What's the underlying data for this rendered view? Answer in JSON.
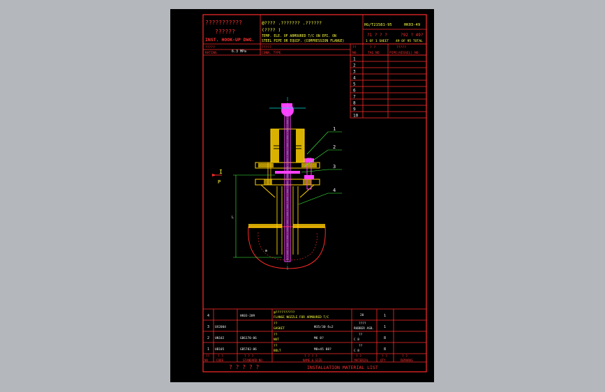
{
  "colors": {
    "frame": "#ff2a2a",
    "text_red": "#ff3030",
    "text_white": "#f0f0f0",
    "text_yellow": "#ffff40",
    "text_green": "#40ff40",
    "magenta": "#ff40ff",
    "cyan": "#00e0e0",
    "leader": "#40ff40",
    "background": "#000000",
    "canvas": "#b4b8bd"
  },
  "header": {
    "company_l1": "???????????",
    "company_l2": "??????",
    "dept": "INST. HOOK-UP DWG.",
    "title_cn": "@???? .??????? .??????",
    "title_cn2": "(???? )",
    "title_en1": "TEMP. ELE. OF ARMOURED T/C ON EPI. ON",
    "title_en2": "STEEL PIPE OR EQUIP. (COMPRESSION FLANGE)",
    "std_code": "HG/T21581-95",
    "dwg_no": "HK03-49",
    "sheet_q": "?1 ? ? ?",
    "sheet_total_q": "?92 ? 49?",
    "sheet_en": "1 OF 1 SHEET",
    "total_en": "49 OF 95 TOTAL",
    "rating_label": "?????",
    "rating_en": "RATING",
    "rating_value": "6.3 MPa",
    "conn_label": "?????",
    "conn_en": "CONN. TYPE"
  },
  "tag_table": {
    "headers": [
      {
        "cn": "??",
        "en": "NO."
      },
      {
        "cn": "? ?",
        "en": "TAG NO"
      },
      {
        "cn": "?????",
        "en": "PIPE(VESSEL) NO."
      }
    ],
    "rows": [
      "1",
      "2",
      "3",
      "4",
      "5",
      "6",
      "7",
      "8",
      "9",
      "10"
    ]
  },
  "drawing": {
    "callouts": [
      "1",
      "2",
      "3",
      "4"
    ],
    "section_mark": "I",
    "section_letter": "P",
    "dim_l": "L",
    "dim_m": "m"
  },
  "bom": {
    "rows": [
      {
        "no": "4",
        "code": "",
        "std": "HK03-209",
        "name_cn": "@??????????",
        "name_en": "FLANGE NOZZLE FOR ARMOURED T/C",
        "spec": "",
        "mat": "20",
        "qty": "1",
        "rem": ""
      },
      {
        "no": "3",
        "code": "UX2004",
        "std": "",
        "name_cn": "??",
        "name_en": "GASKET",
        "spec": "Φ35/30  δ=2",
        "mat_cn": "????",
        "mat": "RUBBER ASB.",
        "qty": "1",
        "rem": ""
      },
      {
        "no": "2",
        "code": "UN102",
        "std": "GB6170-86",
        "name_cn": "??",
        "name_en": "NUT",
        "spec": "M6  8?",
        "mat_cn": "??",
        "mat": "C 8",
        "qty": "8",
        "rem": ""
      },
      {
        "no": "1",
        "code": "UB105",
        "std": "GB5782-86",
        "name_cn": "??",
        "name_en": "BOLT",
        "spec": "M8×45  88?",
        "mat_cn": "??",
        "mat": "C 8",
        "qty": "8",
        "rem": ""
      }
    ],
    "headers": [
      {
        "cn": "??",
        "en": "NO"
      },
      {
        "cn": "? ?",
        "en": "CODE"
      },
      {
        "cn": "? ? ?",
        "en": "STANDARD NO."
      },
      {
        "cn": "? ? ? ?",
        "en": "NAME & SIZE"
      },
      {
        "cn": "? ?",
        "en": "MATERIAL"
      },
      {
        "cn": "? ?",
        "en": "QTY"
      },
      {
        "cn": "? ?",
        "en": "REMARKS"
      }
    ],
    "footer_cn": "? ? ? ? ?",
    "footer_en": "INSTALLATION MATERIAL LIST"
  }
}
